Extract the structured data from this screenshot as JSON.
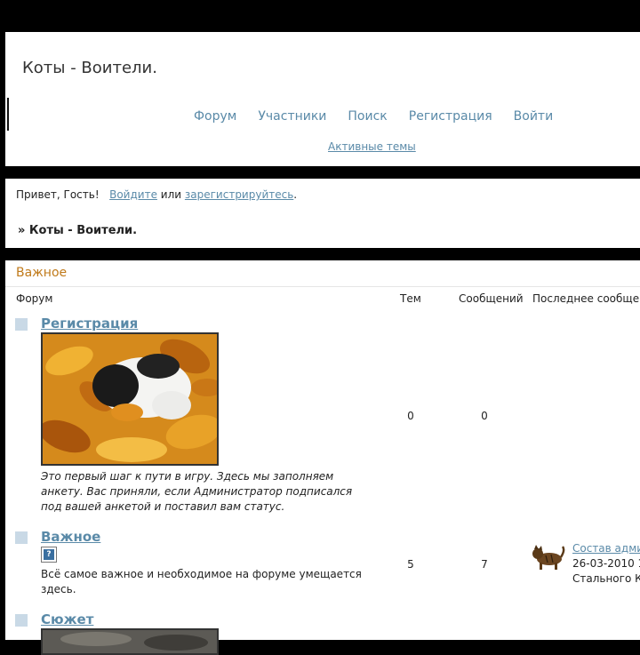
{
  "header": {
    "site_title": "Коты - Воители.",
    "nav": [
      "Форум",
      "Участники",
      "Поиск",
      "Регистрация",
      "Войти"
    ],
    "active_topics": "Активные темы"
  },
  "welcome": {
    "greeting": "Привет, Гость!",
    "login": "Войдите",
    "or": "или",
    "register": "зарегистрируйтесь",
    "dot": "."
  },
  "breadcrumb": "» Коты - Воители.",
  "category": {
    "title": "Важное",
    "columns": {
      "forum": "Форум",
      "topics": "Тем",
      "posts": "Сообщений",
      "last": "Последнее сообщение"
    }
  },
  "forums": [
    {
      "title": "Регистрация",
      "description": "Это первый шаг к пути в игру. Здесь мы заполняем анкету. Вас приняли, если Администратор подписался под вашей анкетой и поставил вам статус.",
      "topics": "0",
      "posts": "0"
    },
    {
      "title": "Важное",
      "icon_text": "?",
      "description": "Всё самое важное и необходимое на форуме умещается здесь.",
      "topics": "5",
      "posts": "7",
      "last_post": {
        "link": "Состав админ",
        "date": "26-03-2010 1",
        "author": "Стального К"
      }
    },
    {
      "title": "Сюжет"
    }
  ],
  "colors": {
    "link": "#5a8aa8",
    "category": "#c07a1a",
    "square": "#c9d9e6"
  }
}
